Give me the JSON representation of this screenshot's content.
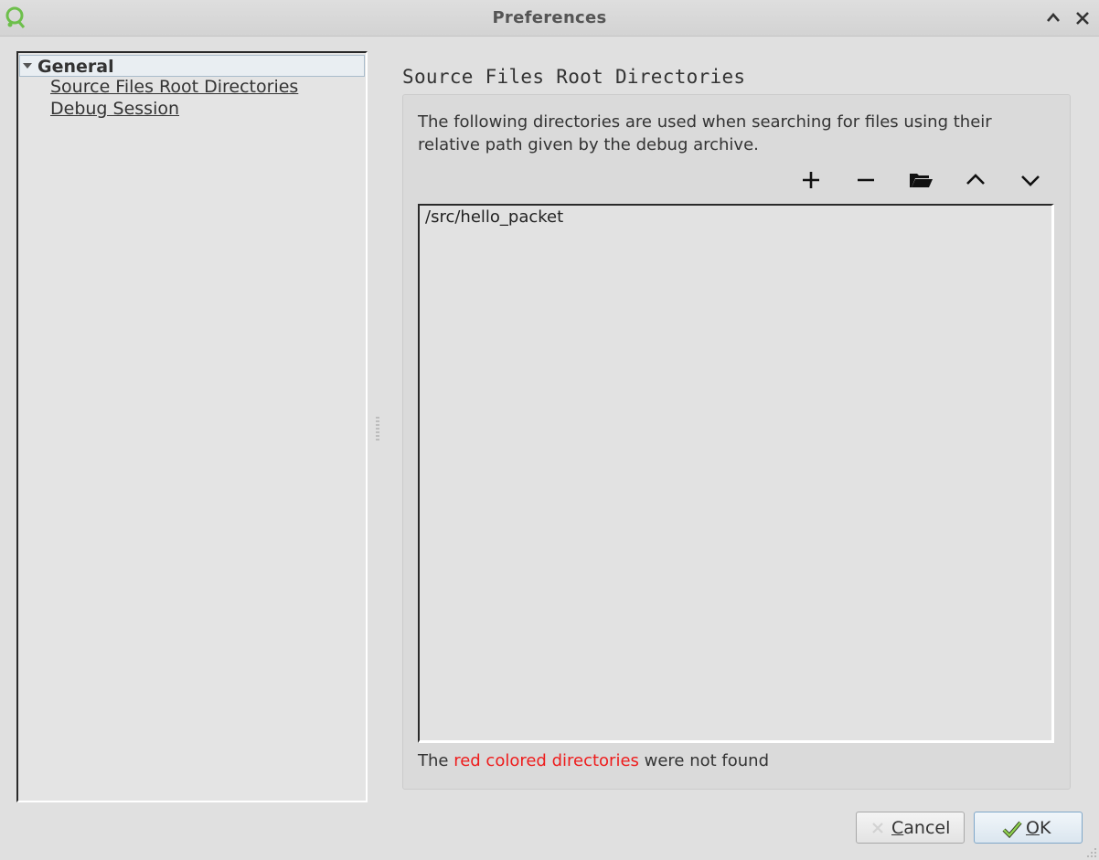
{
  "window": {
    "title": "Preferences",
    "icons": {
      "app": "app-logo-icon",
      "maximize": "chevron-up-icon",
      "close": "close-icon"
    }
  },
  "tree": {
    "root": {
      "label": "General",
      "icon": "expand-triangle-icon"
    },
    "children": [
      {
        "label": "Source Files Root Directories"
      },
      {
        "label": "Debug Session"
      }
    ]
  },
  "section": {
    "title": "Source Files Root Directories",
    "description": "The following directories are used when searching for files using their relative path given by the debug archive.",
    "toolbar": [
      {
        "icon": "plus-icon"
      },
      {
        "icon": "minus-icon"
      },
      {
        "icon": "folder-open-icon"
      },
      {
        "icon": "chevron-up-icon"
      },
      {
        "icon": "chevron-down-icon"
      }
    ],
    "directories": [
      "/src/hello_packet"
    ],
    "note": {
      "prefix": "The ",
      "highlight": "red colored directories",
      "suffix": " were not found",
      "highlight_color": "#ee1c1c"
    }
  },
  "buttons": {
    "cancel": {
      "mnemonic": "C",
      "rest": "ancel",
      "icon": "cancel-x-icon"
    },
    "ok": {
      "mnemonic": "O",
      "rest": "K",
      "icon": "checkmark-icon"
    }
  }
}
